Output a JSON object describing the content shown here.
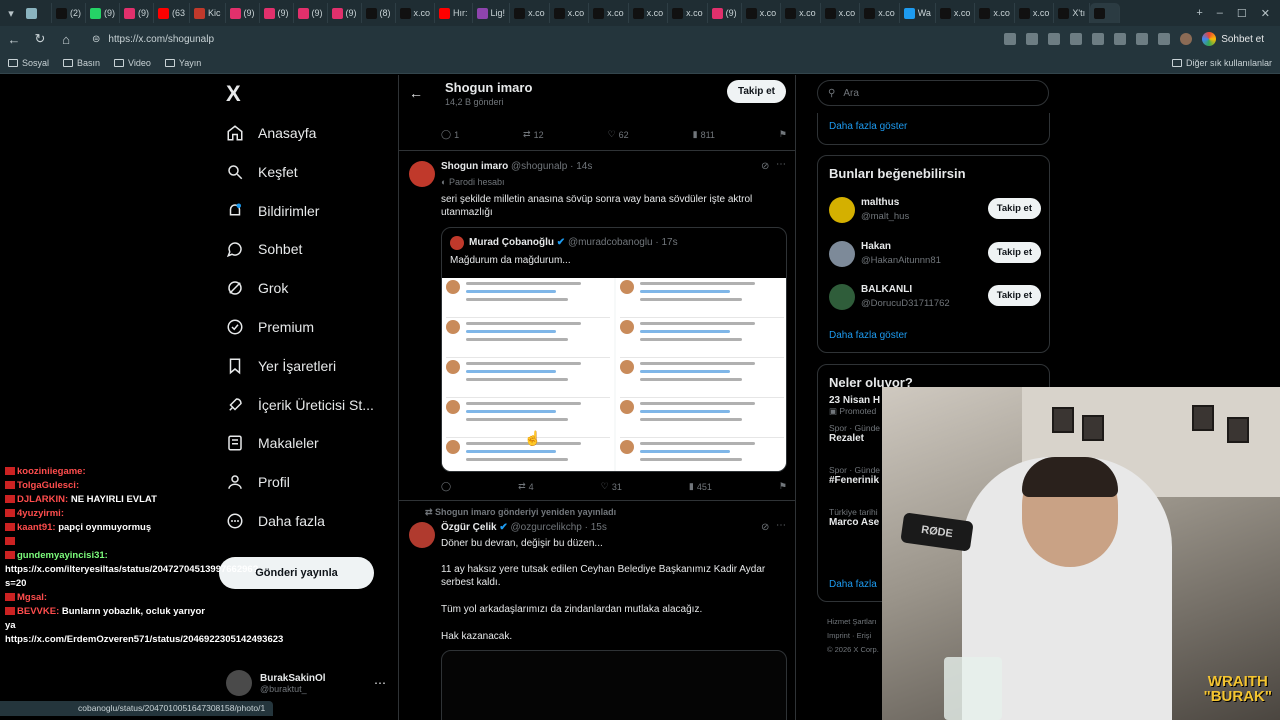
{
  "browser": {
    "tabs": [
      {
        "label": "",
        "color": "#8ab4c0"
      },
      {
        "label": "(2)",
        "color": "#111111"
      },
      {
        "label": "(9)",
        "color": "#25d366"
      },
      {
        "label": "(9)",
        "color": "#e1306c"
      },
      {
        "label": "(63",
        "color": "#ff0000"
      },
      {
        "label": "Kic",
        "color": "#c0392b"
      },
      {
        "label": "(9)",
        "color": "#e1306c"
      },
      {
        "label": "(9)",
        "color": "#e1306c"
      },
      {
        "label": "(9)",
        "color": "#e1306c"
      },
      {
        "label": "(9)",
        "color": "#e1306c"
      },
      {
        "label": "(8)",
        "color": "#111111"
      },
      {
        "label": "x.co",
        "color": "#111111"
      },
      {
        "label": "Hır:",
        "color": "#ff0000"
      },
      {
        "label": "Lig!",
        "color": "#8e44ad"
      },
      {
        "label": "x.co",
        "color": "#111111"
      },
      {
        "label": "x.co",
        "color": "#111111"
      },
      {
        "label": "x.co",
        "color": "#111111"
      },
      {
        "label": "x.co",
        "color": "#111111"
      },
      {
        "label": "x.co",
        "color": "#111111"
      },
      {
        "label": "(9)",
        "color": "#e1306c"
      },
      {
        "label": "x.co",
        "color": "#111111"
      },
      {
        "label": "x.co",
        "color": "#111111"
      },
      {
        "label": "x.co",
        "color": "#111111"
      },
      {
        "label": "x.co",
        "color": "#111111"
      },
      {
        "label": "Wa",
        "color": "#1d9bf0"
      },
      {
        "label": "x.co",
        "color": "#111111"
      },
      {
        "label": "x.co",
        "color": "#111111"
      },
      {
        "label": "x.co",
        "color": "#111111"
      },
      {
        "label": "X'tı",
        "color": "#111111"
      },
      {
        "label": "",
        "color": "#111111"
      }
    ],
    "url": "https://x.com/shogunalp",
    "chat_button": "Sohbet et",
    "bookmarks": [
      "Sosyal",
      "Basın",
      "Video",
      "Yayın"
    ],
    "bookmarks_right": "Diğer sık kullanılanlar",
    "status_url": "cobanoglu/status/2047010051647308158/photo/1"
  },
  "sidebar": {
    "logo": "X",
    "items": [
      {
        "label": "Anasayfa",
        "icon": "home-icon"
      },
      {
        "label": "Keşfet",
        "icon": "search-icon"
      },
      {
        "label": "Bildirimler",
        "icon": "bell-icon"
      },
      {
        "label": "Sohbet",
        "icon": "chat-icon"
      },
      {
        "label": "Grok",
        "icon": "grok-icon"
      },
      {
        "label": "Premium",
        "icon": "verified-icon"
      },
      {
        "label": "Yer İşaretleri",
        "icon": "bookmark-icon"
      },
      {
        "label": "İçerik Üreticisi St...",
        "icon": "rocket-icon"
      },
      {
        "label": "Makaleler",
        "icon": "article-icon"
      },
      {
        "label": "Profil",
        "icon": "person-icon"
      },
      {
        "label": "Daha fazla",
        "icon": "more-circle-icon"
      }
    ],
    "post_button": "Gönderi yayınla",
    "account": {
      "name": "BurakSakinOl",
      "handle": "@buraktut_"
    }
  },
  "profile_header": {
    "title": "Shogun imaro",
    "subtitle": "14,2 B gönderi",
    "follow": "Takip et"
  },
  "posts": [
    {
      "actions": {
        "replies": "1",
        "reposts": "12",
        "likes": "62",
        "views": "811"
      }
    },
    {
      "name": "Shogun imaro",
      "handle": "@shogunalp · 14s",
      "parody": "Parodi hesabı",
      "text": "seri şekilde milletin anasına sövüp sonra way bana sövdüler işte aktrol utanmazlığı",
      "quote": {
        "name": "Murad Çobanoğlu",
        "handle": "@muradcobanoglu · 17s",
        "text": "Mağdurum da mağdurum..."
      },
      "actions": {
        "replies": "",
        "reposts": "4",
        "likes": "31",
        "views": "451"
      }
    },
    {
      "repost_label": "Shogun imaro gönderiyi yeniden yayınladı",
      "name": "Özgür Çelik",
      "handle": "@ozgurcelikchp · 15s",
      "lines": [
        "Döner bu devran, değişir bu düzen...",
        "11 ay haksız yere tutsak edilen Ceyhan Belediye Başkanımız Kadir Aydar serbest kaldı.",
        "Tüm yol arkadaşlarımızı da zindanlardan mutlaka alacağız.",
        "Hak kazanacak."
      ]
    }
  ],
  "right": {
    "search_placeholder": "Ara",
    "more_link_1": "Daha fazla göster",
    "who_title": "Bunları beğenebilirsin",
    "who": [
      {
        "name": "malthus",
        "handle": "@malt_hus",
        "button": "Takip et",
        "color": "#d4b000"
      },
      {
        "name": "Hakan",
        "handle": "@HakanAitunnn81",
        "button": "Takip et",
        "color": "#7d8a99"
      },
      {
        "name": "BALKANLI",
        "handle": "@DorucuD31711762",
        "button": "Takip et",
        "color": "#2f5d3a"
      }
    ],
    "more_link_2": "Daha fazla göster",
    "trends_title": "Neler oluyor?",
    "trends": [
      {
        "category": "",
        "title": "23 Nisan H",
        "extra": "Promoted"
      },
      {
        "category": "Spor · Günde",
        "title": "Rezalet"
      },
      {
        "category": "Spor · Günde",
        "title": "#Fenerinik"
      },
      {
        "category": "Türkiye tarihi",
        "title": "Marco Ase"
      }
    ],
    "more_link_3": "Daha fazla",
    "footer": [
      "Hizmet Şartları",
      "Imprint · Erişi",
      "© 2026 X Corp."
    ]
  },
  "chat": [
    {
      "user": "kooziniiegame:",
      "text": ""
    },
    {
      "user": "TolgaGulesci:",
      "text": ""
    },
    {
      "user": "DJLARKIN:",
      "text": " NE HAYIRLI EVLAT"
    },
    {
      "user": "4yuzyirmi:",
      "text": ""
    },
    {
      "user": "kaant91:",
      "text": " papçi oynmuyormuş"
    },
    {
      "user": "",
      "text": ""
    },
    {
      "user": "gundemyayincisi31:",
      "text": " https://x.com/ilteryesiltas/status/2047270451399766296?s=20"
    },
    {
      "user": "Mgsal:",
      "text": ""
    },
    {
      "user": "BEVVKE:",
      "text": " Bunların yobazlık, ocluk yarıyor ya https://x.com/ErdemOzveren571/status/2046922305142493623"
    }
  ],
  "stream": {
    "mic_label": "RØDE",
    "overlay_line1": "WRAITH",
    "overlay_line2": "\"BURAK\""
  }
}
